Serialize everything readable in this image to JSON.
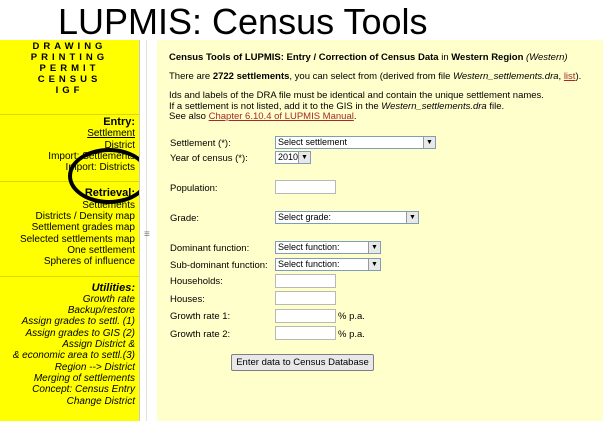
{
  "app_title": "LUPMIS: Census Tools",
  "sidebar": {
    "top_items": [
      "DRAWING",
      "PRINTING",
      "PERMIT",
      "CENSUS",
      "IGF"
    ],
    "entry": {
      "heading": "Entry:",
      "items": [
        "Settlement",
        "District",
        "Import: Settlements",
        "Import: Districts"
      ]
    },
    "retrieval": {
      "heading": "Retrieval:",
      "items": [
        "Settlements",
        "Districts / Density map",
        "Settlement grades map",
        "Selected settlements map",
        "One settlement",
        "Spheres of influence"
      ]
    },
    "utilities": {
      "heading": "Utilities:",
      "items": [
        "Growth rate",
        "Backup/restore",
        "Assign grades to settl. (1)",
        "Assign grades to GIS (2)",
        "Assign District &",
        "& economic area to settl.(3)",
        "Region --> District",
        "Merging of settlements",
        "Concept: Census Entry",
        "Change District"
      ]
    }
  },
  "main": {
    "title_prefix": "Census Tools of LUPMIS: Entry / Correction of Census Data",
    "title_in": "in",
    "region": "Western Region",
    "region_paren": "(Western)",
    "count_pre": "There are",
    "count": "2722 settlements",
    "count_mid": ", you can select from (derived from file",
    "count_file": "Western_settlements.dra",
    "count_comma": ",",
    "count_list": "list",
    "count_end": ").",
    "note1": "Ids and labels of the DRA file must be identical and contain the unique settlement names.",
    "note2_pre": "If a settlement is not listed, add it to the GIS in the",
    "note2_file": "Western_settlements.dra",
    "note2_end": "file.",
    "note3_pre": "See also",
    "note3_link": "Chapter 6.10.4 of LUPMIS Manual",
    "note3_end": "."
  },
  "form": {
    "settlement_label": "Settlement (*):",
    "settlement_value": "Select settlement",
    "year_label": "Year of census (*):",
    "year_value": "2010",
    "population_label": "Population:",
    "grade_label": "Grade:",
    "grade_value": "Select grade:",
    "dominant_label": "Dominant function:",
    "dominant_value": "Select function:",
    "subdominant_label": "Sub-dominant function:",
    "subdominant_value": "Select function:",
    "households_label": "Households:",
    "houses_label": "Houses:",
    "growth1_label": "Growth rate 1:",
    "growth2_label": "Growth rate 2:",
    "pa_suffix": "% p.a.",
    "submit_label": "Enter data to Census Database"
  },
  "colors": {
    "sidebar_bg": "#ffff00",
    "main_bg": "#ffffcc",
    "link": "#a52a2a"
  },
  "icons": {
    "dropdown": "chevron-down-icon",
    "splitter_grip": "grip-icon"
  }
}
